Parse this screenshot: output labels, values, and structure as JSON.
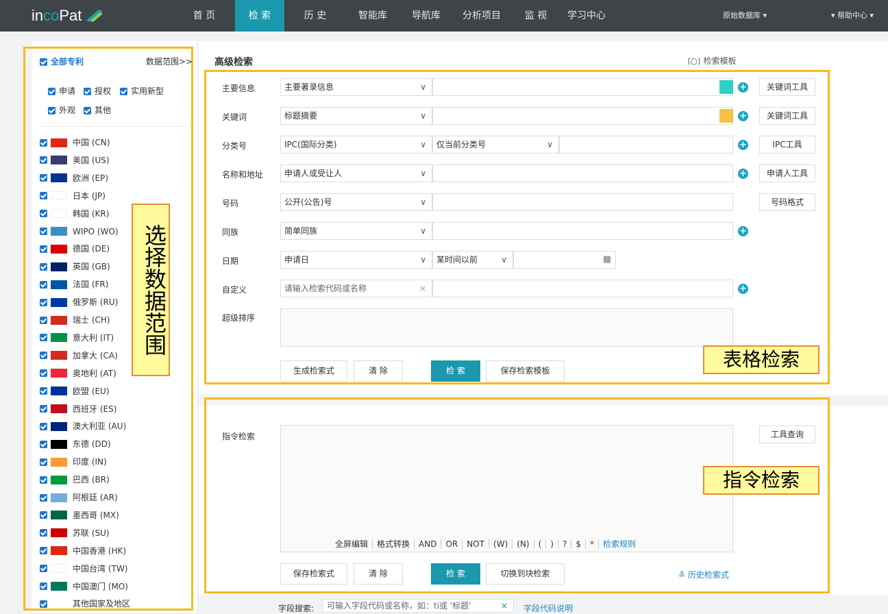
{
  "nav": {
    "logo_in": "in",
    "logo_co": "co",
    "logo_pat": "Pat",
    "items": [
      "首 页",
      "检 索",
      "历 史",
      "智能库",
      "导航库",
      "分析项目",
      "监 视",
      "学习中心"
    ],
    "raw_db": "原始数据库",
    "help": "帮助中心"
  },
  "sidebar": {
    "all_patents": "全部专利",
    "data_range": "数据范围>>",
    "types": [
      "申请",
      "授权",
      "实用新型",
      "外观",
      "其他"
    ],
    "countries": [
      {
        "name": "中国 (CN)",
        "flag": "#de2910"
      },
      {
        "name": "美国 (US)",
        "flag": "#3c3b6e"
      },
      {
        "name": "欧洲 (EP)",
        "flag": "#003399"
      },
      {
        "name": "日本 (JP)",
        "flag": "#ffffff"
      },
      {
        "name": "韩国 (KR)",
        "flag": "#ffffff"
      },
      {
        "name": "WIPO (WO)",
        "flag": "#3a8fc8"
      },
      {
        "name": "德国 (DE)",
        "flag": "#dd0000"
      },
      {
        "name": "英国 (GB)",
        "flag": "#012169"
      },
      {
        "name": "法国 (FR)",
        "flag": "#0055a4"
      },
      {
        "name": "俄罗斯 (RU)",
        "flag": "#0039a6"
      },
      {
        "name": "瑞士 (CH)",
        "flag": "#d52b1e"
      },
      {
        "name": "意大利 (IT)",
        "flag": "#009246"
      },
      {
        "name": "加拿大 (CA)",
        "flag": "#d52b1e"
      },
      {
        "name": "奥地利 (AT)",
        "flag": "#ed2939"
      },
      {
        "name": "欧盟 (EU)",
        "flag": "#003399"
      },
      {
        "name": "西班牙 (ES)",
        "flag": "#c60b1e"
      },
      {
        "name": "澳大利亚 (AU)",
        "flag": "#00247d"
      },
      {
        "name": "东德 (DD)",
        "flag": "#000000"
      },
      {
        "name": "印度 (IN)",
        "flag": "#ff9933"
      },
      {
        "name": "巴西 (BR)",
        "flag": "#009c3b"
      },
      {
        "name": "阿根廷 (AR)",
        "flag": "#74acdf"
      },
      {
        "name": "墨西哥 (MX)",
        "flag": "#006847"
      },
      {
        "name": "苏联 (SU)",
        "flag": "#cc0000"
      },
      {
        "name": "中国香港 (HK)",
        "flag": "#de2910"
      },
      {
        "name": "中国台湾 (TW)",
        "flag": "#ffffff"
      },
      {
        "name": "中国澳门 (MO)",
        "flag": "#00785e"
      },
      {
        "name": "其他国家及地区",
        "flag": ""
      }
    ]
  },
  "annotations": {
    "range": "选择数据范围",
    "form": "表格检索",
    "command": "指令检索"
  },
  "form": {
    "title": "高级检索",
    "template_link": "检索模板",
    "rows": [
      {
        "label": "主要信息",
        "select": "主要著录信息",
        "tool": "关键词工具"
      },
      {
        "label": "关键词",
        "select": "标题摘要",
        "tool": "关键词工具"
      },
      {
        "label": "分类号",
        "select": "IPC(国际分类)",
        "select2": "仅当前分类号",
        "tool": "IPC工具"
      },
      {
        "label": "名称和地址",
        "select": "申请人或受让人",
        "tool": "申请人工具"
      },
      {
        "label": "号码",
        "select": "公开(公告)号",
        "tool": "号码格式"
      },
      {
        "label": "同族",
        "select": "简单同族"
      },
      {
        "label": "日期",
        "select": "申请日",
        "select2": "某时间以前"
      },
      {
        "label": "自定义",
        "placeholder": "请输入检索代码或名称"
      },
      {
        "label": "超级排序"
      }
    ],
    "swatch_colors": [
      "#2fd0c8",
      "#f7c244"
    ],
    "buttons": {
      "generate": "生成检索式",
      "clear": "清 除",
      "search": "检 索",
      "save_template": "保存检索模板"
    }
  },
  "command": {
    "label": "指令检索",
    "tool": "工具查询",
    "ops": [
      "全屏编辑",
      "格式转换",
      "AND",
      "OR",
      "NOT",
      "(W)",
      "(N)",
      "(",
      ")",
      "?",
      "$",
      "*"
    ],
    "rules": "检索规则",
    "buttons": {
      "save": "保存检索式",
      "clear": "清 除",
      "search": "检 索",
      "switch": "切换到块检索"
    },
    "history": "历史检索式"
  },
  "field_search": {
    "label": "字段搜索:",
    "placeholder": "可输入字段代码或名称，如：ti或 '标题'",
    "desc": "字段代码说明"
  }
}
